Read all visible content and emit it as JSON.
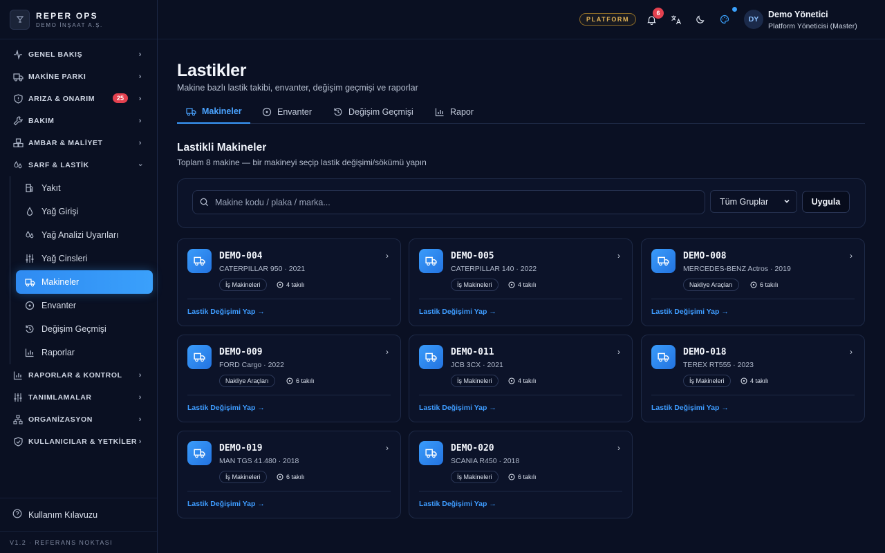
{
  "brand": {
    "title": "REPER OPS",
    "subtitle": "DEMO İNŞAAT A.Ş."
  },
  "sidebar": {
    "items": [
      {
        "label": "GENEL BAKIŞ",
        "icon": "activity-icon"
      },
      {
        "label": "MAKİNE PARKI",
        "icon": "truck-icon"
      },
      {
        "label": "ARIZA & ONARIM",
        "icon": "shield-icon",
        "badge": "25"
      },
      {
        "label": "BAKIM",
        "icon": "wrench-icon"
      },
      {
        "label": "AMBAR & MALİYET",
        "icon": "boxes-icon"
      },
      {
        "label": "SARF & LASTİK",
        "icon": "droplets-icon",
        "expanded": true
      }
    ],
    "subitems": [
      {
        "label": "Yakıt",
        "icon": "fuel-icon"
      },
      {
        "label": "Yağ Girişi",
        "icon": "droplet-icon"
      },
      {
        "label": "Yağ Analizi Uyarıları",
        "icon": "droplets-icon"
      },
      {
        "label": "Yağ Cinsleri",
        "icon": "sliders-icon"
      },
      {
        "label": "Makineler",
        "icon": "truck-icon",
        "active": true
      },
      {
        "label": "Envanter",
        "icon": "disc-icon"
      },
      {
        "label": "Değişim Geçmişi",
        "icon": "history-icon"
      },
      {
        "label": "Raporlar",
        "icon": "bar-chart-icon"
      }
    ],
    "items_after": [
      {
        "label": "RAPORLAR & KONTROL",
        "icon": "bar-chart-icon"
      },
      {
        "label": "TANIMLAMALAR",
        "icon": "sliders-icon"
      },
      {
        "label": "ORGANİZASYON",
        "icon": "network-icon"
      },
      {
        "label": "KULLANICILAR & YETKİLER",
        "icon": "shield-check-icon"
      }
    ],
    "guide": "Kullanım Kılavuzu",
    "version": "V1.2 · REFERANS NOKTASI"
  },
  "topbar": {
    "platform": "PLATFORM",
    "notifications": "6",
    "user_initials": "DY",
    "user_name": "Demo Yönetici",
    "user_role": "Platform Yöneticisi (Master)"
  },
  "page": {
    "title": "Lastikler",
    "subtitle": "Makine bazlı lastik takibi, envanter, değişim geçmişi ve raporlar",
    "tabs": [
      {
        "label": "Makineler",
        "active": true
      },
      {
        "label": "Envanter"
      },
      {
        "label": "Değişim Geçmişi"
      },
      {
        "label": "Rapor"
      }
    ],
    "section_title": "Lastikli Makineler",
    "section_subtitle": "Toplam 8 makine — bir makineyi seçip lastik değişimi/sökümü yapın"
  },
  "filter": {
    "search_placeholder": "Makine kodu / plaka / marka...",
    "group_select": "Tüm Gruplar",
    "apply": "Uygula"
  },
  "machines": [
    {
      "code": "DEMO-004",
      "model": "CATERPILLAR 950 · 2021",
      "group": "İş Makineleri",
      "tires": "4 takılı",
      "action": "Lastik Değişimi Yap →"
    },
    {
      "code": "DEMO-005",
      "model": "CATERPILLAR 140 · 2022",
      "group": "İş Makineleri",
      "tires": "4 takılı",
      "action": "Lastik Değişimi Yap →"
    },
    {
      "code": "DEMO-008",
      "model": "MERCEDES-BENZ Actros · 2019",
      "group": "Nakliye Araçları",
      "tires": "6 takılı",
      "action": "Lastik Değişimi Yap →"
    },
    {
      "code": "DEMO-009",
      "model": "FORD Cargo · 2022",
      "group": "Nakliye Araçları",
      "tires": "6 takılı",
      "action": "Lastik Değişimi Yap →"
    },
    {
      "code": "DEMO-011",
      "model": "JCB 3CX · 2021",
      "group": "İş Makineleri",
      "tires": "4 takılı",
      "action": "Lastik Değişimi Yap →"
    },
    {
      "code": "DEMO-018",
      "model": "TEREX RT555 · 2023",
      "group": "İş Makineleri",
      "tires": "4 takılı",
      "action": "Lastik Değişimi Yap →"
    },
    {
      "code": "DEMO-019",
      "model": "MAN TGS 41.480 · 2018",
      "group": "İş Makineleri",
      "tires": "6 takılı",
      "action": "Lastik Değişimi Yap →"
    },
    {
      "code": "DEMO-020",
      "model": "SCANIA R450 · 2018",
      "group": "İş Makineleri",
      "tires": "6 takılı",
      "action": "Lastik Değişimi Yap →"
    }
  ],
  "colors": {
    "accent": "#3b9bff",
    "background": "#0a1023",
    "danger": "#e4414f",
    "platform": "#e3b456"
  }
}
